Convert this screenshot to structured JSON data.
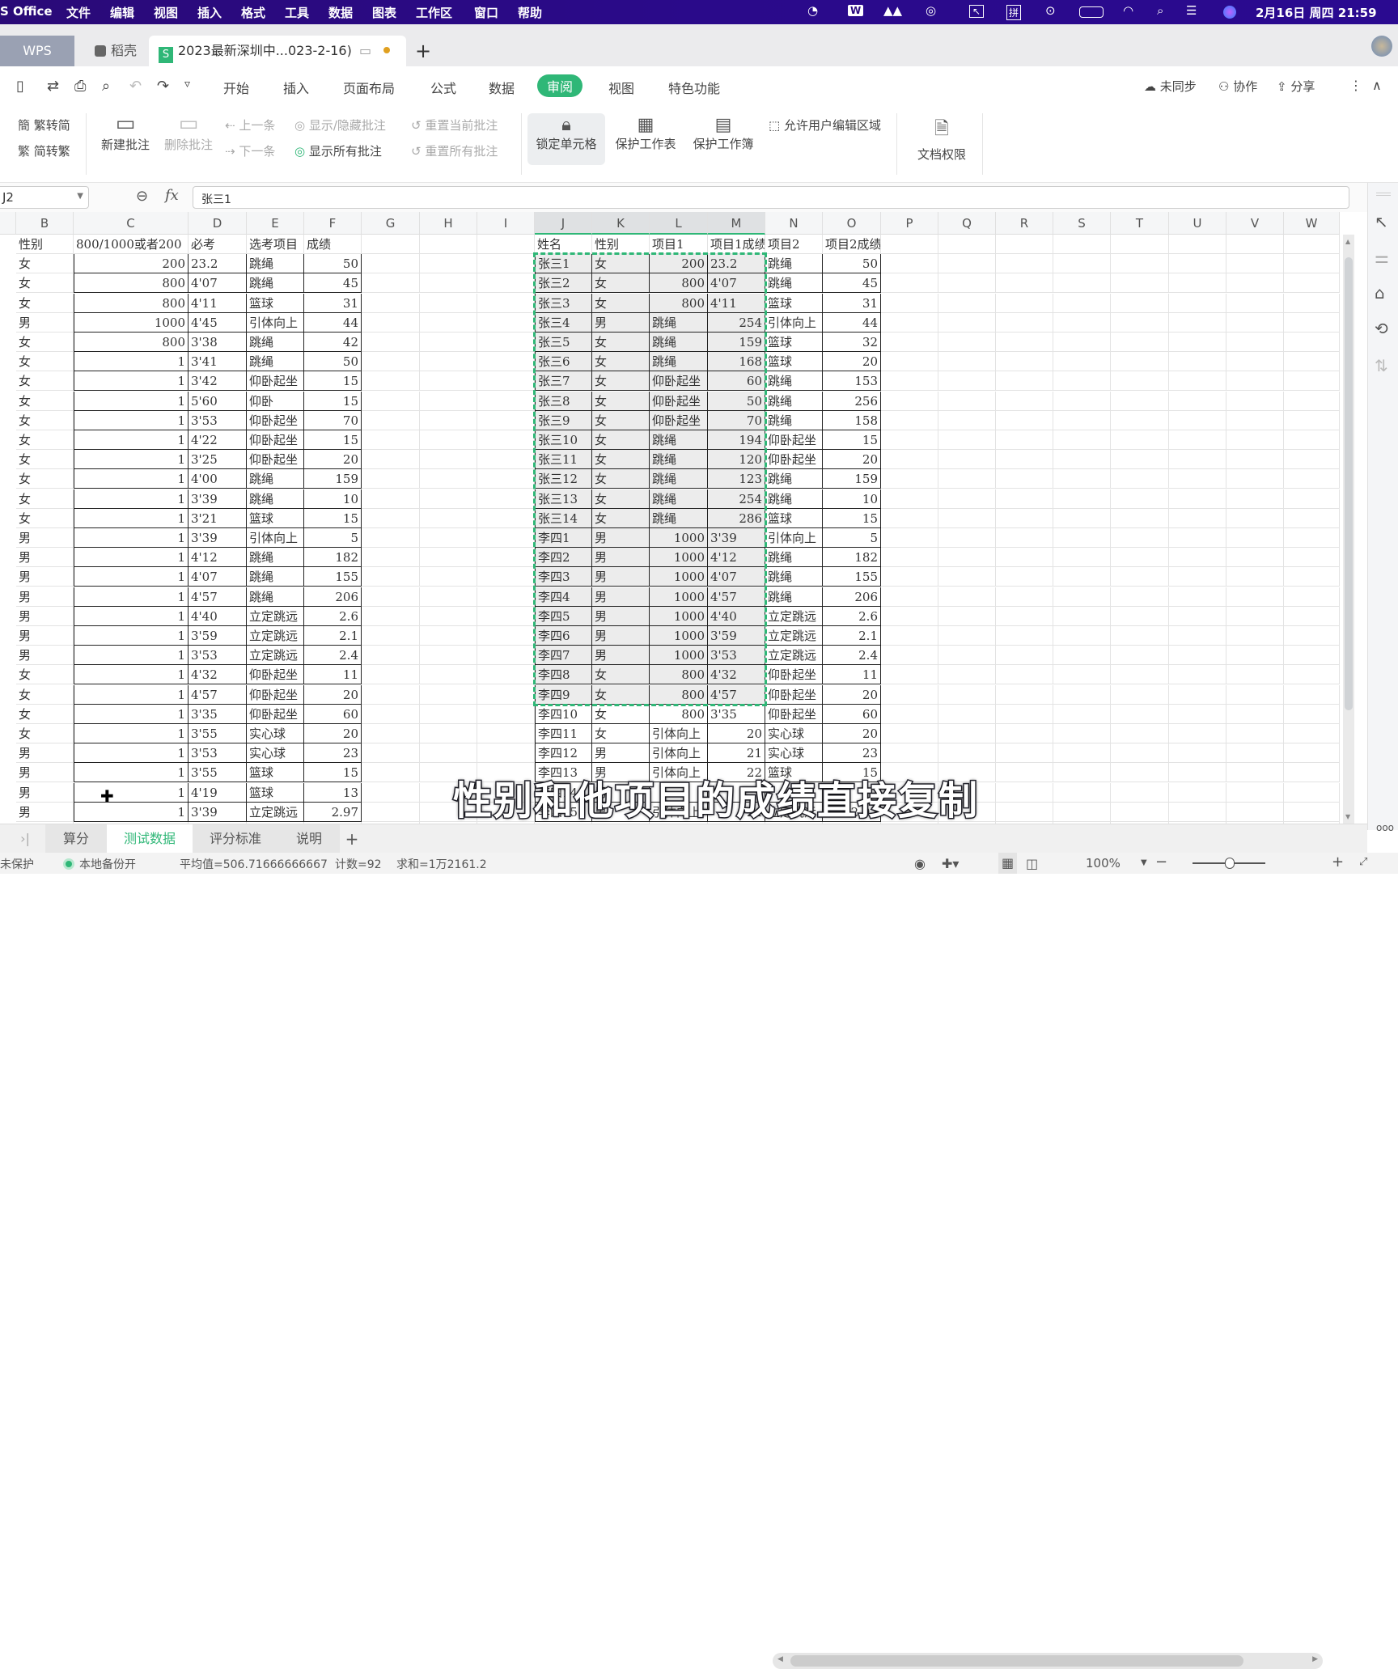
{
  "menubar": {
    "app": "S Office",
    "items": [
      "文件",
      "编辑",
      "视图",
      "插入",
      "格式",
      "工具",
      "数据",
      "图表",
      "工作区",
      "窗口",
      "帮助"
    ],
    "clock": "2月16日 周四 21:59",
    "tray_icons": [
      "obs-icon",
      "wps-icon",
      "cloud-app-icon",
      "screen-record-icon",
      "pointer-app-icon",
      "input-method-icon",
      "play-icon",
      "battery-icon",
      "wifi-icon",
      "search-icon",
      "control-center-icon",
      "siri-icon"
    ],
    "input_method_label": "拼"
  },
  "tabs": {
    "home": "WPS",
    "docer": "稻壳",
    "document": "2023最新深圳中...023-2-16)",
    "add": "+"
  },
  "ribbon_tabs": [
    "开始",
    "插入",
    "页面布局",
    "公式",
    "数据",
    "审阅",
    "视图",
    "特色功能"
  ],
  "active_ribbon_tab": "审阅",
  "ribbon_right": {
    "sync": "未同步",
    "collab": "协作",
    "share": "分享"
  },
  "toolbar": {
    "trad_to_simp": "繁转简",
    "simp_to_trad": "简转繁",
    "new_comment": "新建批注",
    "delete_comment": "删除批注",
    "prev": "上一条",
    "next": "下一条",
    "show_hide_comments": "显示/隐藏批注",
    "show_all_comments": "显示所有批注",
    "reset_current_comment": "重置当前批注",
    "reset_all_comments": "重置所有批注",
    "lock_cells": "锁定单元格",
    "protect_sheet": "保护工作表",
    "protect_workbook": "保护工作簿",
    "allow_edit_ranges": "允许用户编辑区域",
    "doc_permissions": "文档权限"
  },
  "formula_bar": {
    "name_box": "J2",
    "fx_label": "fx",
    "value": "张三1"
  },
  "columns": [
    "B",
    "C",
    "D",
    "E",
    "F",
    "G",
    "H",
    "I",
    "J",
    "K",
    "L",
    "M",
    "N",
    "O",
    "P",
    "Q",
    "R",
    "S",
    "T",
    "U",
    "V",
    "W"
  ],
  "selected_columns": [
    "J",
    "K",
    "L",
    "M"
  ],
  "left_table": {
    "headers": [
      "性别",
      "800/1000或者200",
      "必考",
      "选考项目",
      "成绩"
    ],
    "rows": [
      [
        "女",
        "200",
        "23.2",
        "跳绳",
        "50"
      ],
      [
        "女",
        "800",
        "4'07",
        "跳绳",
        "45"
      ],
      [
        "女",
        "800",
        "4'11",
        "篮球",
        "31"
      ],
      [
        "男",
        "1000",
        "4'45",
        "引体向上",
        "44"
      ],
      [
        "女",
        "800",
        "3'38",
        "跳绳",
        "42"
      ],
      [
        "女",
        "1",
        "3'41",
        "跳绳",
        "50"
      ],
      [
        "女",
        "1",
        "3'42",
        "仰卧起坐",
        "15"
      ],
      [
        "女",
        "1",
        "5'60",
        "仰卧",
        "15"
      ],
      [
        "女",
        "1",
        "3'53",
        "仰卧起坐",
        "70"
      ],
      [
        "女",
        "1",
        "4'22",
        "仰卧起坐",
        "15"
      ],
      [
        "女",
        "1",
        "3'25",
        "仰卧起坐",
        "20"
      ],
      [
        "女",
        "1",
        "4'00",
        "跳绳",
        "159"
      ],
      [
        "女",
        "1",
        "3'39",
        "跳绳",
        "10"
      ],
      [
        "女",
        "1",
        "3'21",
        "篮球",
        "15"
      ],
      [
        "男",
        "1",
        "3'39",
        "引体向上",
        "5"
      ],
      [
        "男",
        "1",
        "4'12",
        "跳绳",
        "182"
      ],
      [
        "男",
        "1",
        "4'07",
        "跳绳",
        "155"
      ],
      [
        "男",
        "1",
        "4'57",
        "跳绳",
        "206"
      ],
      [
        "男",
        "1",
        "4'40",
        "立定跳远",
        "2.6"
      ],
      [
        "男",
        "1",
        "3'59",
        "立定跳远",
        "2.1"
      ],
      [
        "男",
        "1",
        "3'53",
        "立定跳远",
        "2.4"
      ],
      [
        "女",
        "1",
        "4'32",
        "仰卧起坐",
        "11"
      ],
      [
        "女",
        "1",
        "4'57",
        "仰卧起坐",
        "20"
      ],
      [
        "女",
        "1",
        "3'35",
        "仰卧起坐",
        "60"
      ],
      [
        "女",
        "1",
        "3'55",
        "实心球",
        "20"
      ],
      [
        "男",
        "1",
        "3'53",
        "实心球",
        "23"
      ],
      [
        "男",
        "1",
        "3'55",
        "篮球",
        "15"
      ],
      [
        "男",
        "1",
        "4'19",
        "篮球",
        "13"
      ],
      [
        "男",
        "1",
        "3'39",
        "立定跳远",
        "2.97"
      ]
    ]
  },
  "right_table": {
    "headers": [
      "姓名",
      "性别",
      "项目1",
      "项目1成绩",
      "项目2",
      "项目2成绩"
    ],
    "rows": [
      [
        "张三1",
        "女",
        "200",
        "23.2",
        "跳绳",
        "50"
      ],
      [
        "张三2",
        "女",
        "800",
        "4'07",
        "跳绳",
        "45"
      ],
      [
        "张三3",
        "女",
        "800",
        "4'11",
        "篮球",
        "31"
      ],
      [
        "张三4",
        "男",
        "跳绳",
        "254",
        "引体向上",
        "44"
      ],
      [
        "张三5",
        "女",
        "跳绳",
        "159",
        "篮球",
        "32"
      ],
      [
        "张三6",
        "女",
        "跳绳",
        "168",
        "篮球",
        "20"
      ],
      [
        "张三7",
        "女",
        "仰卧起坐",
        "60",
        "跳绳",
        "153"
      ],
      [
        "张三8",
        "女",
        "仰卧起坐",
        "50",
        "跳绳",
        "256"
      ],
      [
        "张三9",
        "女",
        "仰卧起坐",
        "70",
        "跳绳",
        "158"
      ],
      [
        "张三10",
        "女",
        "跳绳",
        "194",
        "仰卧起坐",
        "15"
      ],
      [
        "张三11",
        "女",
        "跳绳",
        "120",
        "仰卧起坐",
        "20"
      ],
      [
        "张三12",
        "女",
        "跳绳",
        "123",
        "跳绳",
        "159"
      ],
      [
        "张三13",
        "女",
        "跳绳",
        "254",
        "跳绳",
        "10"
      ],
      [
        "张三14",
        "女",
        "跳绳",
        "286",
        "篮球",
        "15"
      ],
      [
        "李四1",
        "男",
        "1000",
        "3'39",
        "引体向上",
        "5"
      ],
      [
        "李四2",
        "男",
        "1000",
        "4'12",
        "跳绳",
        "182"
      ],
      [
        "李四3",
        "男",
        "1000",
        "4'07",
        "跳绳",
        "155"
      ],
      [
        "李四4",
        "男",
        "1000",
        "4'57",
        "跳绳",
        "206"
      ],
      [
        "李四5",
        "男",
        "1000",
        "4'40",
        "立定跳远",
        "2.6"
      ],
      [
        "李四6",
        "男",
        "1000",
        "3'59",
        "立定跳远",
        "2.1"
      ],
      [
        "李四7",
        "男",
        "1000",
        "3'53",
        "立定跳远",
        "2.4"
      ],
      [
        "李四8",
        "女",
        "800",
        "4'32",
        "仰卧起坐",
        "11"
      ],
      [
        "李四9",
        "女",
        "800",
        "4'57",
        "仰卧起坐",
        "20"
      ],
      [
        "李四10",
        "女",
        "800",
        "3'35",
        "仰卧起坐",
        "60"
      ],
      [
        "李四11",
        "女",
        "引体向上",
        "20",
        "实心球",
        "20"
      ],
      [
        "李四12",
        "男",
        "引体向上",
        "21",
        "实心球",
        "23"
      ],
      [
        "李四13",
        "男",
        "引体向上",
        "22",
        "篮球",
        "15"
      ],
      [
        "李四14",
        "男",
        "",
        "",
        "",
        ""
      ],
      [
        "李四15",
        "男",
        "引体向上",
        "24",
        "立定跳远",
        "2.97"
      ]
    ],
    "selected_row_count": 23
  },
  "sheet_tabs": [
    "算分",
    "测试数据",
    "评分标准",
    "说明"
  ],
  "active_sheet": "测试数据",
  "status": {
    "protect": "未保护",
    "backup": "本地备份开",
    "average": "平均值=506.71666666667",
    "count": "计数=92",
    "sum": "求和=1万2161.2",
    "zoom": "100%"
  },
  "subtitle": "性别和他项目的成绩直接复制",
  "colors": {
    "accent": "#2fb777",
    "menubar": "#2a0a80",
    "selection_fill": "#ececec"
  }
}
